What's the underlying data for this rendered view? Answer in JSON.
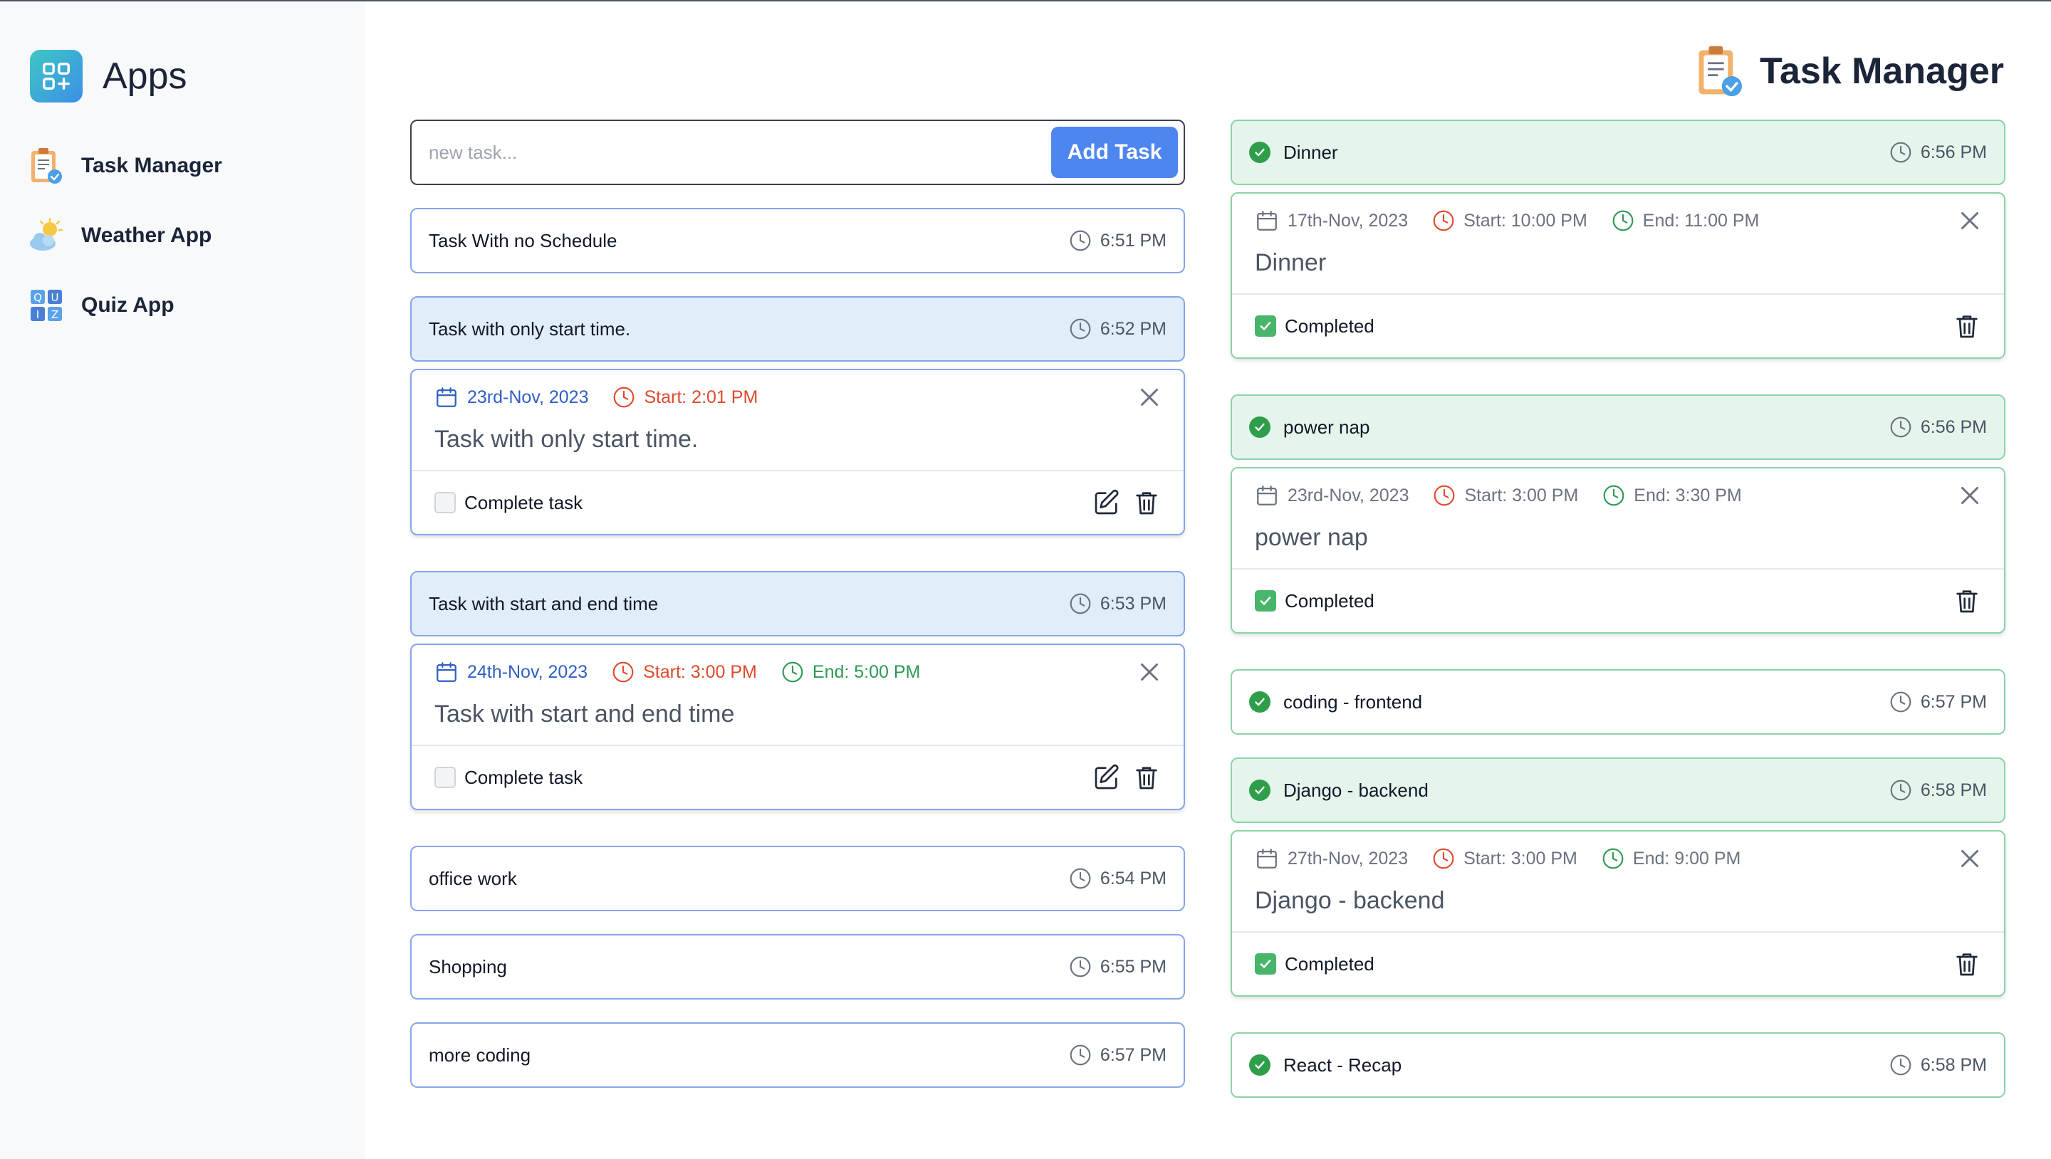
{
  "sidebar": {
    "brand": "Apps",
    "items": [
      {
        "label": "Task Manager",
        "icon": "clipboard-icon"
      },
      {
        "label": "Weather App",
        "icon": "weather-icon"
      },
      {
        "label": "Quiz App",
        "icon": "quiz-icon"
      }
    ]
  },
  "header": {
    "title": "Task Manager"
  },
  "add": {
    "placeholder": "new task...",
    "button": "Add Task"
  },
  "left": {
    "t1": {
      "title": "Task With no Schedule",
      "time": "6:51 PM"
    },
    "t2": {
      "title": "Task with only start time.",
      "time": "6:52 PM",
      "date": "23rd-Nov, 2023",
      "start": "Start: 2:01 PM",
      "body": "Task with only start time.",
      "complete": "Complete task"
    },
    "t3": {
      "title": "Task with start and end time",
      "time": "6:53 PM",
      "date": "24th-Nov, 2023",
      "start": "Start: 3:00 PM",
      "end": "End: 5:00 PM",
      "body": "Task with start and end time",
      "complete": "Complete task"
    },
    "t4": {
      "title": "office work",
      "time": "6:54 PM"
    },
    "t5": {
      "title": "Shopping",
      "time": "6:55 PM"
    },
    "t6": {
      "title": "more coding",
      "time": "6:57 PM"
    }
  },
  "right": {
    "r1": {
      "title": "Dinner",
      "time": "6:56 PM",
      "date": "17th-Nov, 2023",
      "start": "Start: 10:00 PM",
      "end": "End: 11:00 PM",
      "body": "Dinner",
      "complete": "Completed"
    },
    "r2": {
      "title": "power nap",
      "time": "6:56 PM",
      "date": "23rd-Nov, 2023",
      "start": "Start: 3:00 PM",
      "end": "End: 3:30 PM",
      "body": "power nap",
      "complete": "Completed"
    },
    "r3": {
      "title": "coding - frontend",
      "time": "6:57 PM"
    },
    "r4": {
      "title": "Django - backend",
      "time": "6:58 PM",
      "date": "27th-Nov, 2023",
      "start": "Start: 3:00 PM",
      "end": "End: 9:00 PM",
      "body": "Django - backend",
      "complete": "Completed"
    },
    "r5": {
      "title": "React - Recap",
      "time": "6:58 PM"
    }
  },
  "colors": {
    "accent": "#4e86f0",
    "done_bg": "#e5f5ec",
    "active_bg": "#e2edfa",
    "start_red": "#e04a2b",
    "end_green": "#2d9a52",
    "date_blue": "#2f5fc4"
  }
}
